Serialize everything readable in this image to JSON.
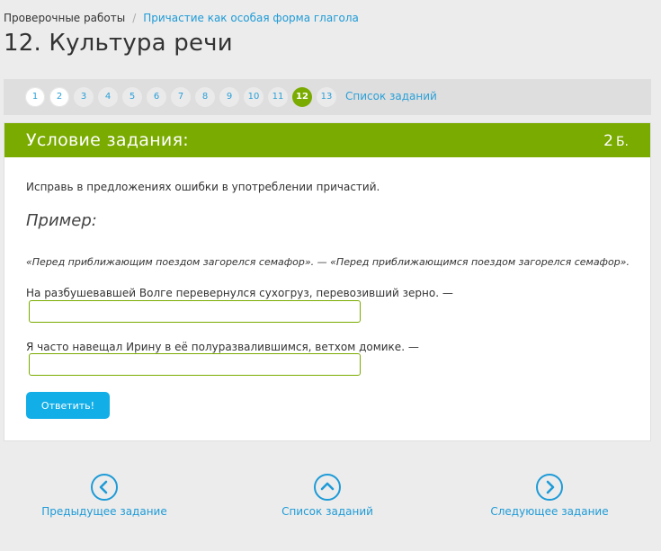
{
  "breadcrumb": {
    "root": "Проверочные работы",
    "separator": "/",
    "current": "Причастие как особая форма глагола"
  },
  "page_title": "12. Культура речи",
  "pager": {
    "items": [
      {
        "label": "1",
        "state": "done"
      },
      {
        "label": "2",
        "state": "done"
      },
      {
        "label": "3",
        "state": "todo"
      },
      {
        "label": "4",
        "state": "todo"
      },
      {
        "label": "5",
        "state": "todo"
      },
      {
        "label": "6",
        "state": "todo"
      },
      {
        "label": "7",
        "state": "todo"
      },
      {
        "label": "8",
        "state": "todo"
      },
      {
        "label": "9",
        "state": "todo"
      },
      {
        "label": "10",
        "state": "todo"
      },
      {
        "label": "11",
        "state": "todo"
      },
      {
        "label": "12",
        "state": "active"
      },
      {
        "label": "13",
        "state": "todo"
      }
    ],
    "list_link": "Список заданий"
  },
  "task": {
    "header_title": "Условие задания:",
    "points_value": "2",
    "points_unit": "Б.",
    "instruction": "Исправь в предложениях ошибки в употреблении причастий.",
    "example_heading": "Пример:",
    "example_text": "«Перед приближающим поездом загорелся семафор». — «Перед приближающимся поездом загорелся семафор».",
    "sentences": [
      {
        "text": "На разбушевавшей Волге перевернулся сухогруз, перевозивший зерно. —",
        "answer_value": ""
      },
      {
        "text": "Я часто навещал Ирину в её полуразвалившимся, ветхом домике. —",
        "answer_value": ""
      }
    ],
    "submit_label": "Ответить!"
  },
  "bottom_nav": {
    "prev_label": "Предыдущее задание",
    "list_label": "Список заданий",
    "next_label": "Следующее задание"
  },
  "colors": {
    "accent_green": "#7aab00",
    "link_blue": "#1e9bd7",
    "button_blue": "#12aee8",
    "page_background": "#ececec"
  },
  "icons": {
    "prev": "chevron-left-circle-icon",
    "list": "chevron-up-circle-icon",
    "next": "chevron-right-circle-icon"
  }
}
